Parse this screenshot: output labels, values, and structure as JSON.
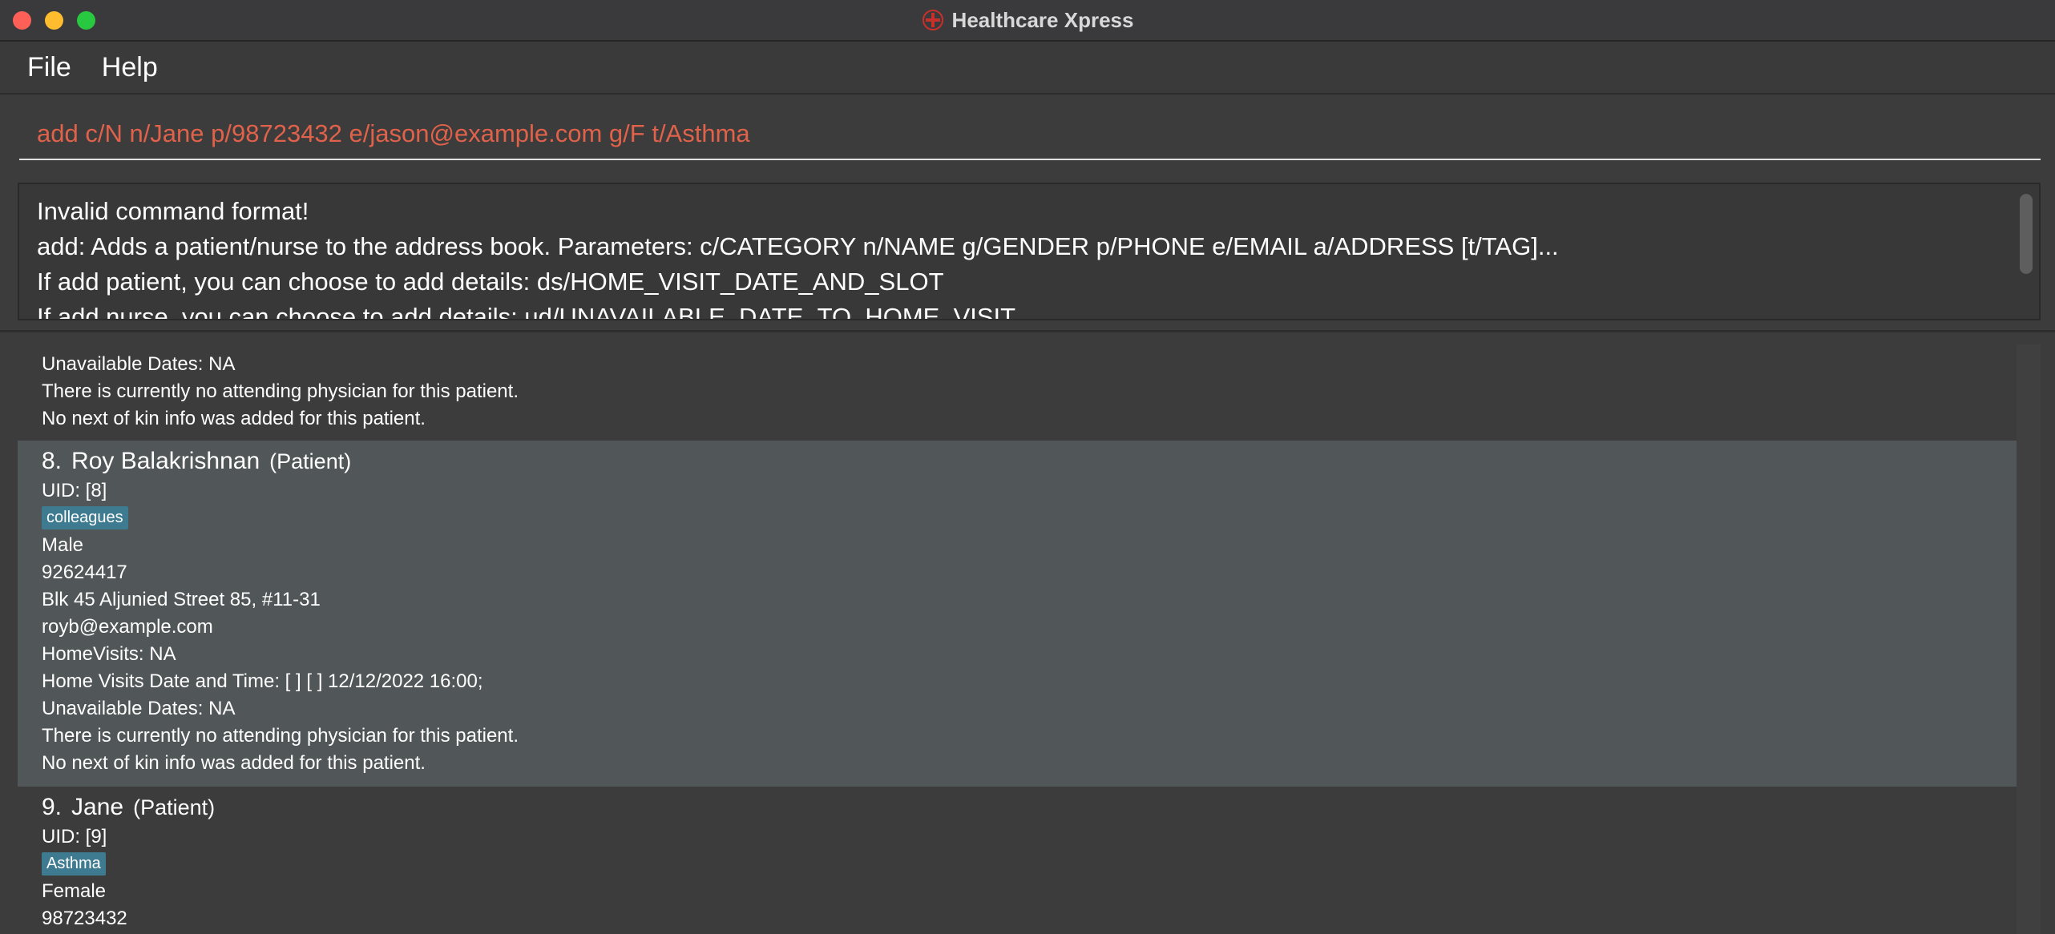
{
  "window": {
    "title": "Healthcare Xpress",
    "accent_color": "#d9362a"
  },
  "menu": {
    "items": [
      "File",
      "Help"
    ]
  },
  "command": {
    "value": "add c/N n/Jane p/98723432 e/jason@example.com g/F t/Asthma",
    "text_color": "#e0624a"
  },
  "result": {
    "lines": [
      "Invalid command format!",
      "add: Adds a patient/nurse to the address book. Parameters: c/CATEGORY n/NAME g/GENDER p/PHONE e/EMAIL a/ADDRESS [t/TAG]...",
      "If add patient, you can choose to add details:  ds/HOME_VISIT_DATE_AND_SLOT",
      "If add nurse, you can choose to add details: ud/UNAVAILABLE_DATE_TO_HOME_VISIT"
    ]
  },
  "list": {
    "partial_card": {
      "lines": [
        "Unavailable Dates: NA",
        "There is currently no attending physician for this patient.",
        "No next of kin info was added for this patient."
      ]
    },
    "cards": [
      {
        "index": "8.",
        "name": "Roy Balakrishnan",
        "category": "(Patient)",
        "uid": "UID: [8]",
        "tag": "colleagues",
        "gender": "Male",
        "phone": "92624417",
        "address": "Blk 45 Aljunied Street 85, #11-31",
        "email": "royb@example.com",
        "home_visits": "HomeVisits: NA",
        "visit_datetime": "Home Visits Date and Time: [ ] [ ] 12/12/2022 16:00;",
        "unavailable": "Unavailable Dates: NA",
        "physician": "There is currently no attending physician for this patient.",
        "next_of_kin": "No next of kin info was added for this patient."
      },
      {
        "index": "9.",
        "name": "Jane",
        "category": "(Patient)",
        "uid": "UID: [9]",
        "tag": "Asthma",
        "gender": "Female",
        "phone": "98723432"
      }
    ]
  }
}
